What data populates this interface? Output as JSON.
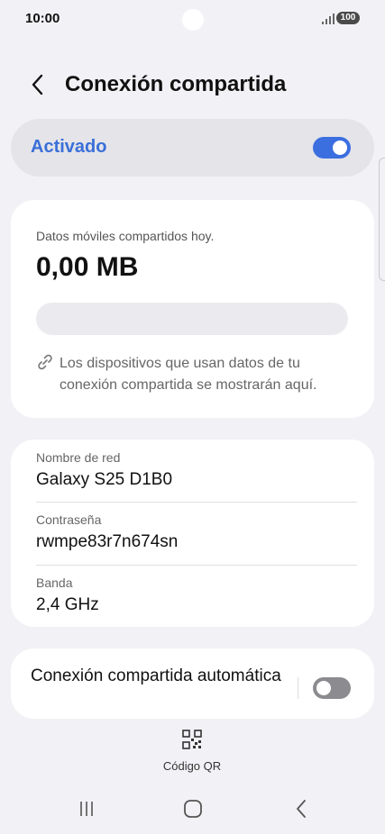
{
  "status": {
    "time": "10:00",
    "battery": "100"
  },
  "header": {
    "title": "Conexión compartida"
  },
  "master": {
    "label": "Activado",
    "on": true
  },
  "usage": {
    "label": "Datos móviles compartidos hoy.",
    "value": "0,00 MB",
    "note": "Los dispositivos que usan datos de tu conexión compartida se mostrarán aquí."
  },
  "network": {
    "rows": [
      {
        "label": "Nombre de red",
        "value": "Galaxy S25 D1B0"
      },
      {
        "label": "Contraseña",
        "value": "rwmpe83r7n674sn"
      },
      {
        "label": "Banda",
        "value": "2,4 GHz"
      }
    ]
  },
  "auto": {
    "label": "Conexión compartida automática",
    "on": false
  },
  "qr": {
    "label": "Código QR"
  },
  "colors": {
    "accent": "#3b6fe0",
    "background": "#f2f2f6"
  }
}
